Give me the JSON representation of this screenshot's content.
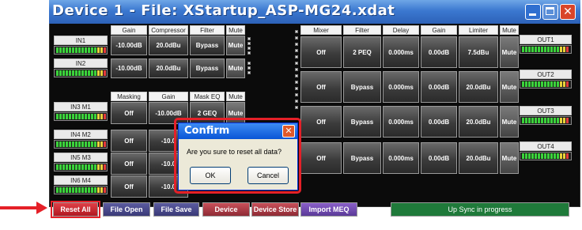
{
  "window": {
    "title": "Device 1  -  File: XStartup_ASP-MG24.xdat",
    "controls": [
      "minimize-icon",
      "maximize-icon",
      "close-icon"
    ]
  },
  "input_section": {
    "headers": [
      "Gain",
      "Compressor",
      "Filter",
      "Mute"
    ],
    "rows": [
      {
        "label": "IN1",
        "gain": "-10.00dB",
        "compressor": "20.0dBu",
        "filter": "Bypass",
        "mute": "Mute"
      },
      {
        "label": "IN2",
        "gain": "-10.00dB",
        "compressor": "20.0dBu",
        "filter": "Bypass",
        "mute": "Mute"
      }
    ]
  },
  "mic_section": {
    "headers": [
      "Masking",
      "Gain",
      "Mask EQ",
      "Mute"
    ],
    "rows": [
      {
        "label": "IN3 M1",
        "masking": "Off",
        "gain": "-10.00dB",
        "mask_eq": "2 GEQ",
        "mute": "Mute"
      },
      {
        "label": "IN4 M2",
        "masking": "Off",
        "gain": "-10.0",
        "mask_eq": "",
        "mute": ""
      },
      {
        "label": "IN5 M3",
        "masking": "Off",
        "gain": "-10.0",
        "mask_eq": "",
        "mute": ""
      },
      {
        "label": "IN6 M4",
        "masking": "Off",
        "gain": "-10.0",
        "mask_eq": "",
        "mute": ""
      }
    ]
  },
  "output_section": {
    "headers": [
      "Mixer",
      "Filter",
      "Delay",
      "Gain",
      "Limiter",
      "Mute"
    ],
    "rows": [
      {
        "label": "OUT1",
        "mixer": "Off",
        "filter": "2 PEQ",
        "delay": "0.000ms",
        "gain": "0.00dB",
        "limiter": "7.5dBu",
        "mute": "Mute"
      },
      {
        "label": "OUT2",
        "mixer": "Off",
        "filter": "Bypass",
        "delay": "0.000ms",
        "gain": "0.00dB",
        "limiter": "20.0dBu",
        "mute": "Mute"
      },
      {
        "label": "OUT3",
        "mixer": "Off",
        "filter": "Bypass",
        "delay": "0.000ms",
        "gain": "0.00dB",
        "limiter": "20.0dBu",
        "mute": "Mute"
      },
      {
        "label": "OUT4",
        "mixer": "Off",
        "filter": "Bypass",
        "delay": "0.000ms",
        "gain": "0.00dB",
        "limiter": "20.0dBu",
        "mute": "Mute"
      }
    ]
  },
  "toolbar": {
    "reset_all": "Reset All",
    "file_open": "File Open",
    "file_save": "File Save",
    "device_recall": "Device Recall",
    "device_store": "Device Store",
    "import_meq": "Import MEQ Data",
    "status": "Up Sync in progress"
  },
  "dialog": {
    "title": "Confirm",
    "message": "Are you sure to reset all data?",
    "ok": "OK",
    "cancel": "Cancel"
  },
  "colors": {
    "title_blue": "#3b78d0",
    "highlight_red": "#e52028",
    "status_green": "#1f7a3a",
    "reset_red": "#c8202a",
    "device_btn_red": "#b0333a"
  }
}
